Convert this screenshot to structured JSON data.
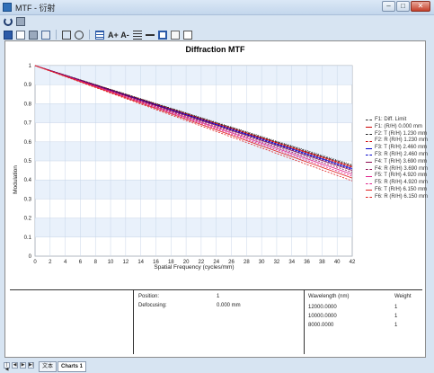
{
  "window": {
    "title": "MTF - 衍射",
    "buttons": [
      "–",
      "□",
      "✕"
    ]
  },
  "toolbar": {
    "row1": [
      "refresh-icon",
      "print-icon"
    ],
    "row2": [
      "save-icon",
      "copy-icon",
      "print-icon",
      "settings-icon",
      "zoom-fit-icon",
      "zoom-icon",
      "legend-icon",
      "font-increase-icon",
      "font-decrease-icon",
      "line-weight-icon",
      "dash-style-icon",
      "frame-icon",
      "annotate-icon",
      "grid-icon"
    ],
    "font_up_label": "A+",
    "font_down_label": "A-"
  },
  "chart_data": {
    "type": "line",
    "title": "Diffraction MTF",
    "xlabel": "Spatial Frequency (cycles/mm)",
    "ylabel": "Modulation",
    "xlim": [
      0,
      42
    ],
    "ylim": [
      0,
      1
    ],
    "x_ticks": [
      0,
      2,
      4,
      6,
      8,
      10,
      12,
      14,
      16,
      18,
      20,
      22,
      24,
      26,
      28,
      30,
      32,
      34,
      36,
      38,
      40,
      42
    ],
    "y_ticks": [
      0,
      0.1,
      0.2,
      0.3,
      0.4,
      0.5,
      0.6,
      0.7,
      0.8,
      0.9,
      1
    ],
    "grid": true,
    "legend_position": "right",
    "series": [
      {
        "name": "F1: Diff. Limit",
        "color": "#333333",
        "dash": "1,1.5",
        "values_at": [
          [
            0,
            1
          ],
          [
            42,
            0.48
          ]
        ]
      },
      {
        "name": "F1: (R/H) 0.000 mm",
        "color": "#cc0000",
        "dash": "",
        "values_at": [
          [
            0,
            1
          ],
          [
            42,
            0.47
          ]
        ]
      },
      {
        "name": "F2: T (R/H) 1.230 mm",
        "color": "#222222",
        "dash": "2,1.5",
        "values_at": [
          [
            0,
            1
          ],
          [
            42,
            0.475
          ]
        ]
      },
      {
        "name": "F2: R (R/H) 1.230 mm",
        "color": "#cc0000",
        "dash": "2,1.5",
        "values_at": [
          [
            0,
            1
          ],
          [
            42,
            0.465
          ]
        ]
      },
      {
        "name": "F3: T (R/H) 2.460 mm",
        "color": "#0000cc",
        "dash": "",
        "values_at": [
          [
            0,
            1
          ],
          [
            42,
            0.46
          ]
        ]
      },
      {
        "name": "F3: R (R/H) 2.460 mm",
        "color": "#0000cc",
        "dash": "2,1.5",
        "values_at": [
          [
            0,
            1
          ],
          [
            42,
            0.455
          ]
        ]
      },
      {
        "name": "F4: T (R/H) 3.690 mm",
        "color": "#8b0a50",
        "dash": "",
        "values_at": [
          [
            0,
            1
          ],
          [
            42,
            0.45
          ]
        ]
      },
      {
        "name": "F4: R (R/H) 3.690 mm",
        "color": "#8b0a50",
        "dash": "2,1.5",
        "values_at": [
          [
            0,
            1
          ],
          [
            42,
            0.44
          ]
        ]
      },
      {
        "name": "F5: T (R/H) 4.920 mm",
        "color": "#e0208a",
        "dash": "",
        "values_at": [
          [
            0,
            1
          ],
          [
            42,
            0.43
          ]
        ]
      },
      {
        "name": "F5: R (R/H) 4.920 mm",
        "color": "#e0208a",
        "dash": "2,1.5",
        "values_at": [
          [
            0,
            1
          ],
          [
            42,
            0.42
          ]
        ]
      },
      {
        "name": "F6: T (R/H) 6.150 mm",
        "color": "#e02020",
        "dash": "",
        "values_at": [
          [
            0,
            1
          ],
          [
            42,
            0.41
          ]
        ]
      },
      {
        "name": "F6: R (R/H) 6.150 mm",
        "color": "#e02020",
        "dash": "2,1.5",
        "values_at": [
          [
            0,
            1
          ],
          [
            42,
            0.395
          ]
        ]
      }
    ]
  },
  "info": {
    "position_label": "Position:",
    "position_value": "1",
    "defocusing_label": "Defocusing:",
    "defocusing_value": "0.000 mm",
    "wavelength_header": "Wavelength (nm)",
    "weight_header": "Weight",
    "wavelengths": [
      {
        "wl": "12000.0000",
        "w": "1"
      },
      {
        "wl": "10000.0000",
        "w": "1"
      },
      {
        "wl": "8000.0000",
        "w": "1"
      }
    ]
  },
  "tabs": {
    "text": "文本",
    "charts": "Charts 1",
    "nav": [
      "|◀",
      "◀",
      "▶",
      "▶|"
    ]
  }
}
